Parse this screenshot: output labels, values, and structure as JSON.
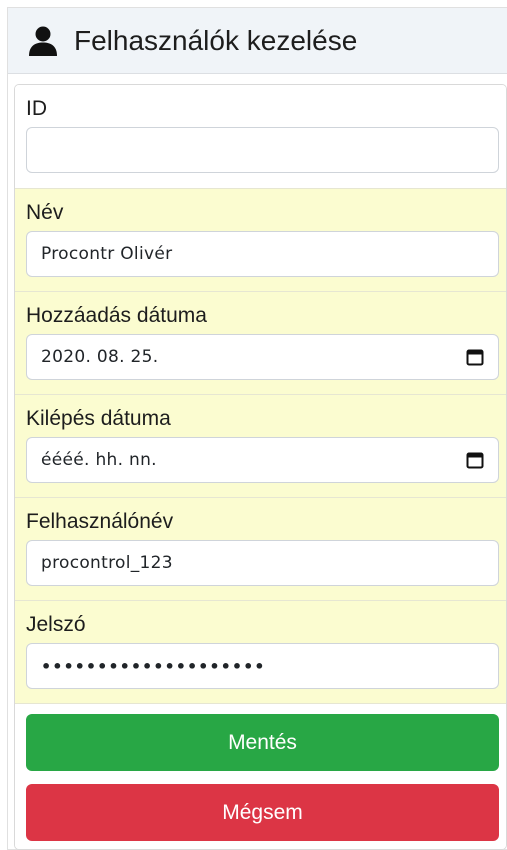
{
  "header": {
    "title": "Felhasználók kezelése",
    "icon": "user-icon"
  },
  "form": {
    "fields": [
      {
        "key": "id",
        "label": "ID",
        "value": ""
      },
      {
        "key": "name",
        "label": "Név",
        "value": "Procontr Olivér"
      },
      {
        "key": "added",
        "label": "Hozzáadás dátuma",
        "value": "2020. 08. 25."
      },
      {
        "key": "exit",
        "label": "Kilépés dátuma",
        "value": "éééé. hh. nn."
      },
      {
        "key": "username",
        "label": "Felhasználónév",
        "value": "procontrol_123"
      },
      {
        "key": "password",
        "label": "Jelszó",
        "value": "••••••••••••••••••••"
      }
    ]
  },
  "buttons": {
    "save": "Mentés",
    "cancel": "Mégsem"
  },
  "colors": {
    "header_bg": "#f0f4f8",
    "highlight_bg": "#fbfcd0",
    "save": "#28a745",
    "cancel": "#dc3545"
  }
}
